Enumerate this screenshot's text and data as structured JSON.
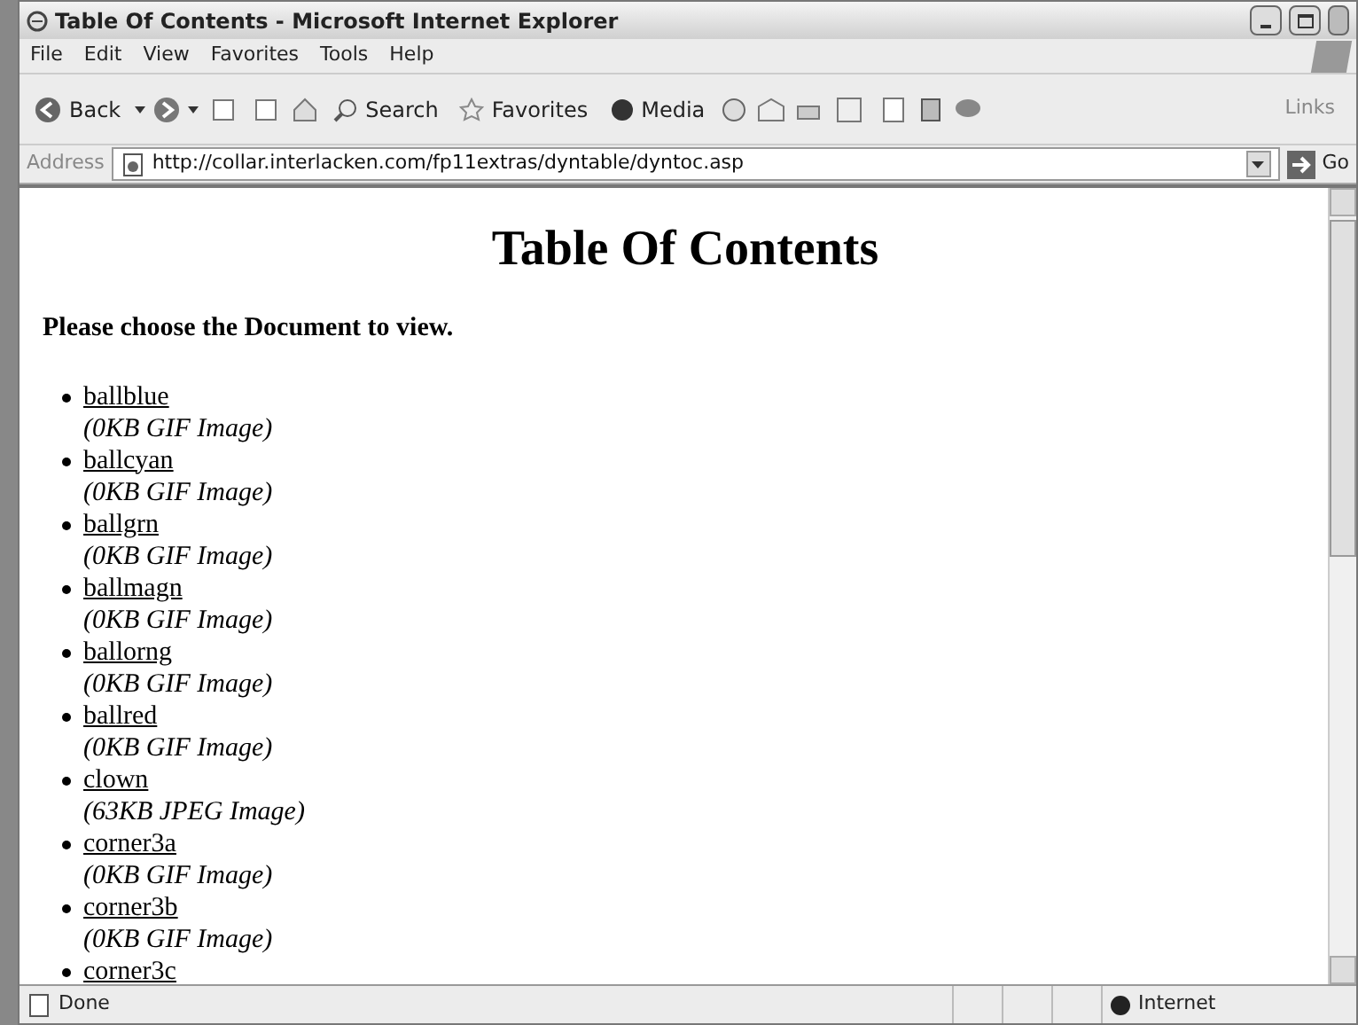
{
  "window": {
    "title": "Table Of Contents - Microsoft Internet Explorer"
  },
  "menu": [
    "File",
    "Edit",
    "View",
    "Favorites",
    "Tools",
    "Help"
  ],
  "toolbar": {
    "back": "Back",
    "search": "Search",
    "favorites": "Favorites",
    "media": "Media",
    "links": "Links"
  },
  "address": {
    "label": "Address",
    "value": "http://collar.interlacken.com/fp11extras/dyntable/dyntoc.asp",
    "go": "Go"
  },
  "page": {
    "heading": "Table Of Contents",
    "prompt": "Please choose the Document to view.",
    "documents": [
      {
        "name": "ballblue",
        "info": "(0KB GIF Image)"
      },
      {
        "name": "ballcyan",
        "info": "(0KB GIF Image)"
      },
      {
        "name": "ballgrn",
        "info": "(0KB GIF Image)"
      },
      {
        "name": "ballmagn",
        "info": "(0KB GIF Image)"
      },
      {
        "name": "ballorng",
        "info": "(0KB GIF Image)"
      },
      {
        "name": "ballred",
        "info": "(0KB GIF Image)"
      },
      {
        "name": "clown",
        "info": "(63KB JPEG Image)"
      },
      {
        "name": "corner3a",
        "info": "(0KB GIF Image)"
      },
      {
        "name": "corner3b",
        "info": "(0KB GIF Image)"
      },
      {
        "name": "corner3c"
      }
    ]
  },
  "status_bar": {
    "text": "Done",
    "zone": "Internet"
  }
}
